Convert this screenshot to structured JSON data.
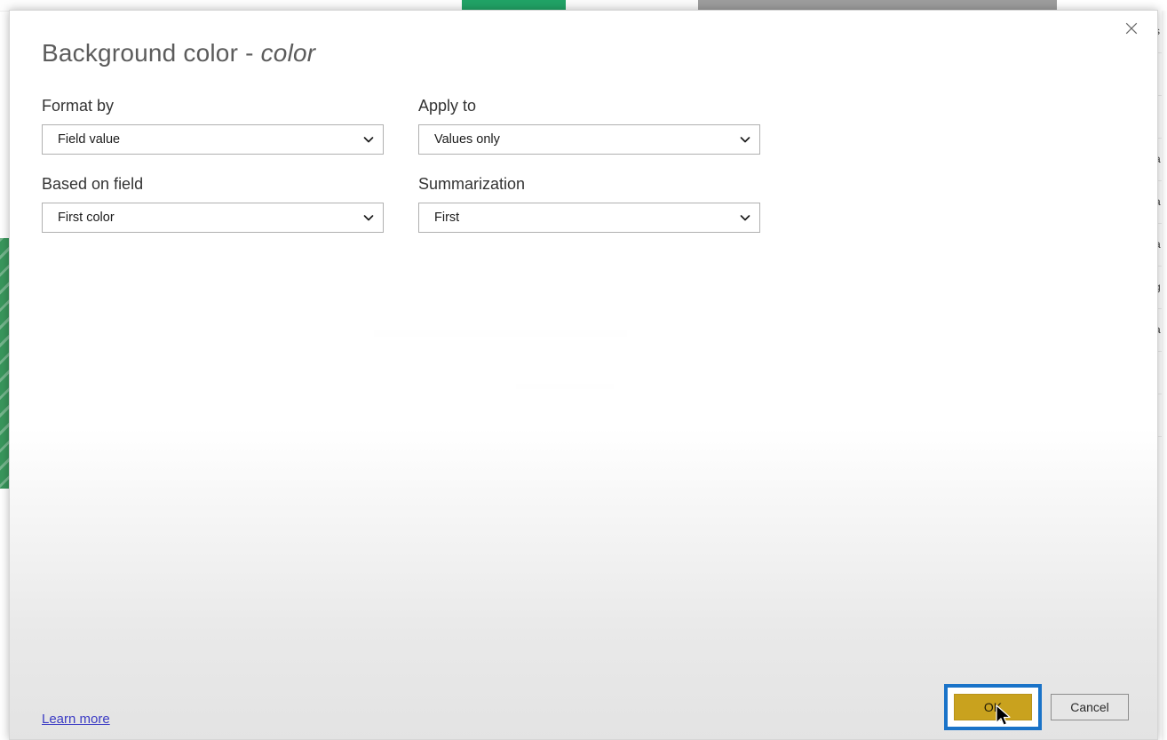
{
  "background": {
    "right_list_rows": [
      "s",
      "",
      "",
      "a",
      "a",
      "a",
      "g",
      "a",
      "",
      ""
    ]
  },
  "dialog": {
    "title_main": "Background color - ",
    "title_field": "color",
    "close_icon": "close-icon",
    "fields": [
      {
        "label": "Format by",
        "value": "Field value",
        "chevron": "chevron-down-icon"
      },
      {
        "label": "Apply to",
        "value": "Values only",
        "chevron": "chevron-down-icon"
      },
      {
        "label": "Based on field",
        "value": "First color",
        "chevron": "chevron-down-icon"
      },
      {
        "label": "Summarization",
        "value": "First",
        "chevron": "chevron-down-icon"
      }
    ],
    "footer": {
      "learn_more": "Learn more",
      "ok_label": "OK",
      "cancel_label": "Cancel"
    }
  },
  "colors": {
    "ok_button": "#c9a21e",
    "ok_highlight": "#1a73c8",
    "link": "#3b3bc4",
    "title_text": "#5c5c5c",
    "excel_green": "#21a366"
  }
}
